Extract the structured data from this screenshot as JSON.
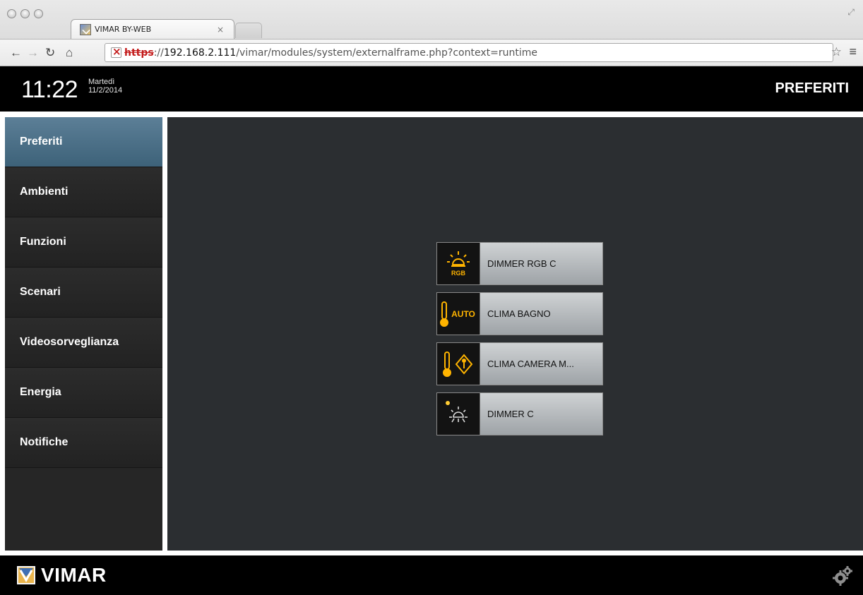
{
  "browser": {
    "tab_title": "VIMAR BY-WEB",
    "tab_close": "×",
    "url_scheme": "https",
    "url_sep": "://",
    "url_host": "192.168.2.111",
    "url_path": "/vimar/modules/system/externalframe.php?context=runtime"
  },
  "header": {
    "time": "11:22",
    "day": "Martedì",
    "date": "11/2/2014",
    "title": "PREFERITI"
  },
  "sidebar": {
    "items": [
      {
        "label": "Preferiti",
        "active": true
      },
      {
        "label": "Ambienti"
      },
      {
        "label": "Funzioni"
      },
      {
        "label": "Scenari"
      },
      {
        "label": "Videosorveglianza"
      },
      {
        "label": "Energia"
      },
      {
        "label": "Notifiche"
      }
    ]
  },
  "favorites": [
    {
      "label": "DIMMER RGB C",
      "icon": "rgb-dimmer-icon",
      "badge": "RGB"
    },
    {
      "label": "CLIMA BAGNO",
      "icon": "thermostat-auto-icon",
      "badge": "AUTO"
    },
    {
      "label": "CLIMA CAMERA M...",
      "icon": "thermostat-manual-icon"
    },
    {
      "label": "DIMMER C",
      "icon": "light-bulb-off-icon"
    }
  ],
  "footer": {
    "brand": "VIMAR"
  },
  "colors": {
    "accent": "#ffb400",
    "active_nav": "#4e7189"
  }
}
